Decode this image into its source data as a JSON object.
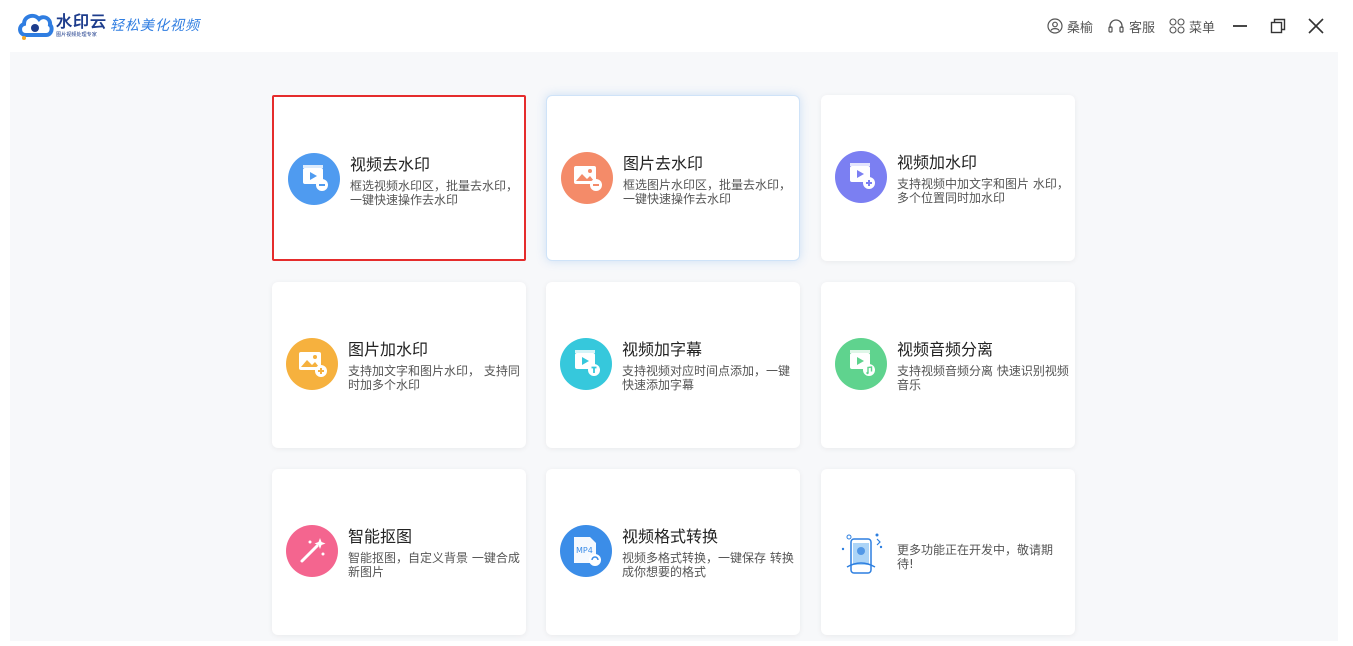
{
  "app": {
    "name": "水印云",
    "subtitle": "图片视频处理专家",
    "slogan": "轻松美化视频"
  },
  "toolbar": {
    "user_label": "桑榆",
    "service_label": "客服",
    "menu_label": "菜单"
  },
  "cards": [
    {
      "title": "视频去水印",
      "desc": "框选视频水印区，批量去水印，一键快速操作去水印",
      "icon": "video-remove-watermark-icon",
      "color": "#4f9bf0"
    },
    {
      "title": "图片去水印",
      "desc": "框选图片水印区，批量去水印，一键快速操作去水印",
      "icon": "image-remove-watermark-icon",
      "color": "#f48b69"
    },
    {
      "title": "视频加水印",
      "desc": "支持视频中加文字和图片 水印，多个位置同时加水印",
      "icon": "video-add-watermark-icon",
      "color": "#7b7ff2"
    },
    {
      "title": "图片加水印",
      "desc": "支持加文字和图片水印， 支持同时加多个水印",
      "icon": "image-add-watermark-icon",
      "color": "#f6b13e"
    },
    {
      "title": "视频加字幕",
      "desc": "支持视频对应时间点添加，一键快速添加字幕",
      "icon": "video-subtitle-icon",
      "color": "#36c8dc"
    },
    {
      "title": "视频音频分离",
      "desc": "支持视频音频分离 快速识别视频音乐",
      "icon": "audio-separate-icon",
      "color": "#5fd38e"
    },
    {
      "title": "智能抠图",
      "desc": "智能抠图，自定义背景 一键合成新图片",
      "icon": "smart-cutout-icon",
      "color": "#f4658f"
    },
    {
      "title": "视频格式转换",
      "desc": "视频多格式转换，一键保存 转换成你想要的格式",
      "icon": "format-convert-icon",
      "color": "#3b8de8",
      "badge": "MP4"
    },
    {
      "title": "",
      "desc": "更多功能正在开发中，敬请期待!",
      "icon": "more-features-icon",
      "color": "#2d7fe0"
    }
  ]
}
